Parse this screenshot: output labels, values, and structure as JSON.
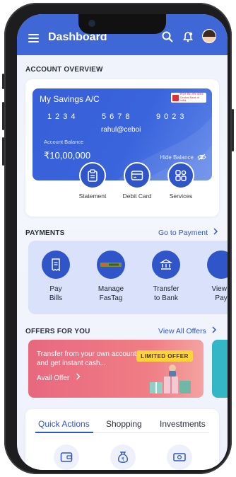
{
  "header": {
    "title": "Dashboard"
  },
  "overview": {
    "section_label": "ACCOUNT OVERVIEW",
    "account_name": "My Savings A/C",
    "card_number_groups": [
      "1234",
      "5678",
      "9023"
    ],
    "upi_id": "rahul@ceboi",
    "balance_label": "Account Balance",
    "balance": "₹10,00,000",
    "hide_balance_label": "Hide Balance",
    "bank_logo_text": [
      "सेन्ट्रल बैंक ऑफ इंडिया",
      "Central Bank of India"
    ],
    "quick_links": [
      {
        "label": "Statement",
        "icon": "clipboard-icon"
      },
      {
        "label": "Debit Card",
        "icon": "card-icon"
      },
      {
        "label": "Services",
        "icon": "services-icon"
      }
    ]
  },
  "payments": {
    "section_label": "PAYMENTS",
    "link_label": "Go to Payment",
    "items": [
      {
        "line1": "Pay",
        "line2": "Bills",
        "icon": "bill-icon"
      },
      {
        "line1": "Manage",
        "line2": "FasTag",
        "icon": "fastag-icon"
      },
      {
        "line1": "Transfer",
        "line2": "to Bank",
        "icon": "bank-icon"
      },
      {
        "line1": "View I",
        "line2": "Pay",
        "icon": "view-icon"
      }
    ]
  },
  "offers": {
    "section_label": "OFFERS FOR YOU",
    "link_label": "View All Offers",
    "card_text": "Transfer from your own account and get instant cash...",
    "cta_label": "Avail Offer",
    "badge": "LIMITED OFFER"
  },
  "tabs": {
    "items": [
      "Quick Actions",
      "Shopping",
      "Investments"
    ],
    "active_index": 0
  },
  "colors": {
    "primary": "#3f67d6",
    "accent": "#2f55c8",
    "offer_pink": "#e8687e",
    "offer_badge": "#ffd43b"
  }
}
